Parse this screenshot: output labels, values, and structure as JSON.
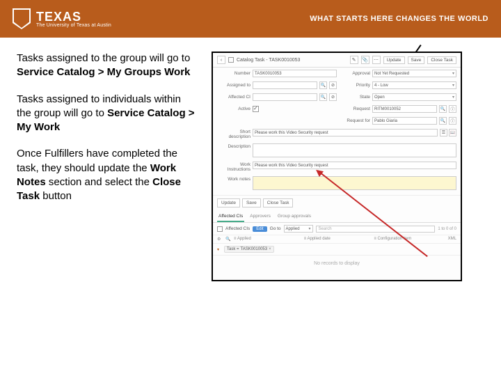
{
  "header": {
    "logo_big": "TEXAS",
    "logo_small": "The University of Texas at Austin",
    "tagline": "WHAT STARTS HERE CHANGES THE WORLD"
  },
  "left_text": {
    "p1_a": "Tasks assigned to the group will go to ",
    "p1_b": "Service Catalog > My Groups Work",
    "p2_a": "Tasks assigned to individuals within the group will go to ",
    "p2_b": "Service Catalog > My Work",
    "p3_a": "Once Fulfillers have completed the task, they should update the ",
    "p3_b": "Work Notes",
    "p3_c": " section and select the ",
    "p3_d": "Close Task",
    "p3_e": " button"
  },
  "panel": {
    "back": "‹",
    "title": "Catalog Task - TASK0010053",
    "edit": "✎",
    "attach": "📎",
    "more": "⋯",
    "btn_update": "Update",
    "btn_save": "Save",
    "btn_close": "Close Task",
    "fields": {
      "number_lbl": "Number",
      "number_val": "TASK0010053",
      "approval_lbl": "Approval",
      "approval_val": "Not Yet Requested",
      "assigned_lbl": "Assigned to",
      "assigned_val": "",
      "priority_lbl": "Priority",
      "priority_val": "4 - Low",
      "affected_lbl": "Affected CI",
      "affected_val": "",
      "state_lbl": "State",
      "state_val": "Open",
      "active_lbl": "Active",
      "request_lbl": "Request",
      "request_val": "RITM0010052",
      "reqfor_lbl": "Request for",
      "reqfor_val": "Pablo Giaria",
      "short_lbl": "Short description",
      "short_val": "Please work this Video Security request",
      "desc_lbl": "Description",
      "workinst_lbl": "Work Instructions",
      "workinst_val": "Please work this Video Security request",
      "worknotes_lbl": "Work notes"
    },
    "actions": {
      "update": "Update",
      "save": "Save",
      "close": "Close Task"
    },
    "tabs": {
      "t1": "Affected CIs",
      "t2": "Approvers",
      "t3": "Group approvals"
    },
    "subtool": {
      "title": "Affected CIs",
      "edit": "Edit",
      "goto": "Go to",
      "goto_val": "Applied",
      "search_ph": "Search",
      "pager": "1 to 0 of 0"
    },
    "thead": {
      "c1": "⚙",
      "c2": "🔍",
      "c3": "≡ Applied",
      "c4": "≡ Applied date",
      "c5": "≡ Configuration item",
      "c6": "XML"
    },
    "row": {
      "tag_lbl": "Task =",
      "tag_val": "TASK0010053"
    },
    "norec": "No records to display"
  }
}
